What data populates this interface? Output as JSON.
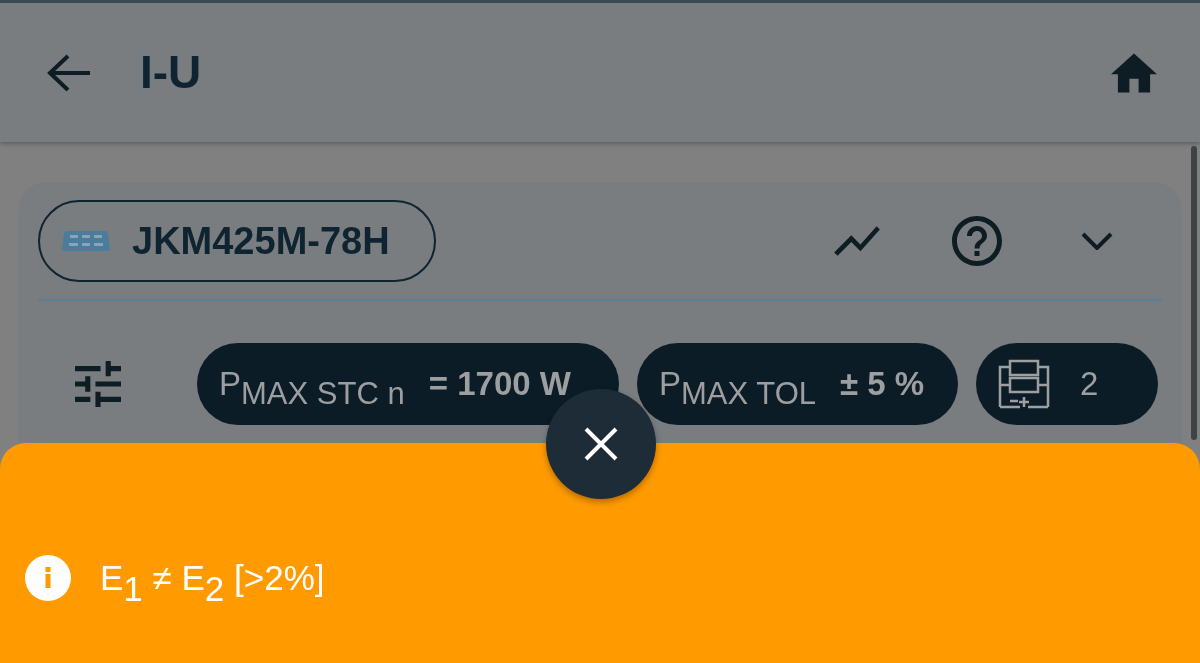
{
  "app_bar": {
    "title": "I-U"
  },
  "module": {
    "name": "JKM425M-78H"
  },
  "parameters": [
    {
      "kind": "value",
      "label": "P$_{MAX STC n}$",
      "value": "= 1700 W"
    },
    {
      "kind": "value",
      "label": "P$_{MAX TOL}$",
      "value": "± 5 %"
    },
    {
      "kind": "count",
      "value": "2"
    }
  ],
  "message": {
    "text": "E$_{1}$ ≠ E$_{2}$ [>2%]"
  }
}
